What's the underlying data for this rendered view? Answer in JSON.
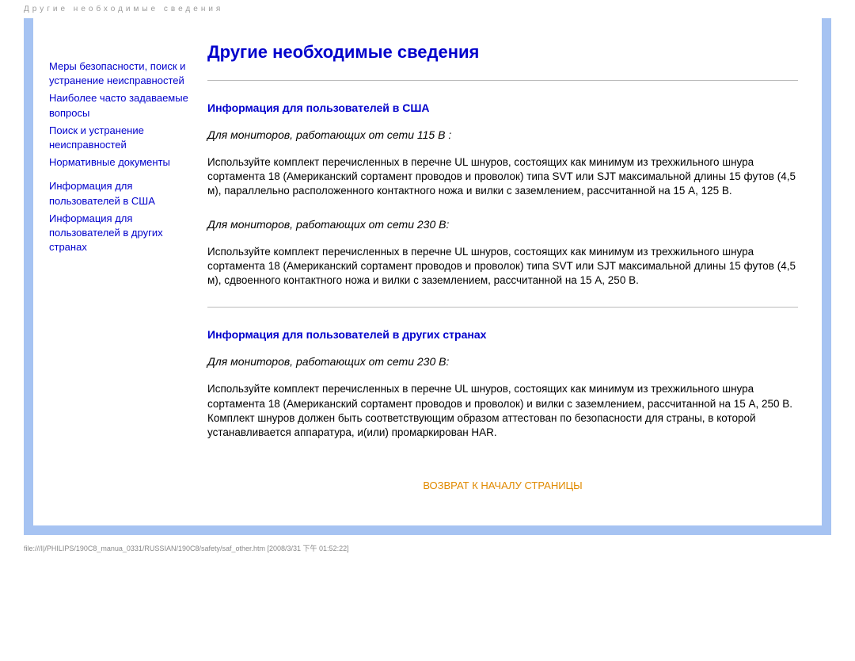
{
  "header": "Другие необходимые сведения",
  "sidebar": {
    "links": [
      "Меры безопасности, поиск и устранение неисправностей",
      "Наиболее часто задаваемые вопросы",
      "Поиск и устранение неисправностей",
      "Нормативные документы",
      "Информация для пользователей в США",
      "Информация для пользователей в других странах"
    ]
  },
  "main": {
    "title": "Другие необходимые сведения",
    "section1": {
      "heading": "Информация для пользователей в США",
      "sub1": "Для мониторов, работающих от сети 115 В :",
      "body1": "Используйте комплект перечисленных в перечне UL шнуров, состоящих как минимум из трехжильного шнура сортамента 18 (Американский сортамент проводов и проволок) типа SVT или SJT максимальной длины 15 футов (4,5 м), параллельно расположенного контактного ножа и вилки с заземлением, рассчитанной на 15 А, 125 В.",
      "sub2": "Для мониторов, работающих от сети 230 В:",
      "body2": "Используйте комплект перечисленных в перечне UL шнуров, состоящих как минимум из трехжильного шнура сортамента 18 (Американский сортамент проводов и проволок) типа SVT или SJT максимальной длины 15 футов (4,5 м), сдвоенного контактного ножа и вилки с заземлением, рассчитанной на 15 А, 250 В."
    },
    "section2": {
      "heading": "Информация для пользователей в других странах",
      "sub1": "Для мониторов, работающих от сети 230 В:",
      "body1": "Используйте комплект перечисленных в перечне UL шнуров, состоящих как минимум из трехжильного шнура сортамента 18 (Американский сортамент проводов и проволок) и вилки с заземлением, рассчитанной на 15 А, 250 В. Комплект шнуров должен быть соответствующим образом аттестован по безопасности для страны, в которой устанавливается аппаратура, и(или) промаркирован HAR."
    },
    "back_top": "ВОЗВРАТ К НАЧАЛУ СТРАНИЦЫ"
  },
  "footer": "file:///I|/PHILIPS/190C8_manua_0331/RUSSIAN/190C8/safety/saf_other.htm [2008/3/31 下午 01:52:22]"
}
